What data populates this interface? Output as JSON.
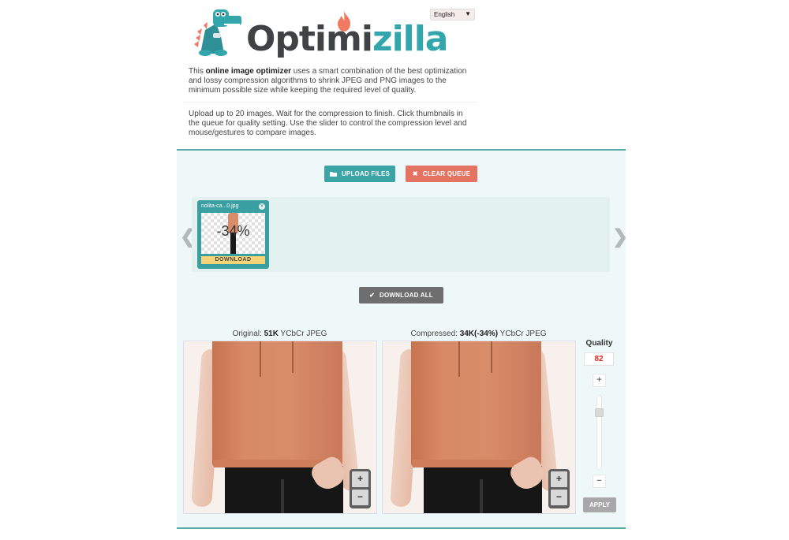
{
  "header": {
    "logo_text_dark": "Optimi",
    "logo_text_teal": "zilla",
    "language": "English"
  },
  "intro": {
    "prefix": "This ",
    "bold": "online image optimizer",
    "suffix": " uses a smart combination of the best optimization and lossy compression algorithms to shrink JPEG and PNG images to the minimum possible size while keeping the required level of quality."
  },
  "howto": "Upload up to 20 images. Wait for the compression to finish. Click thumbnails in the queue for quality setting. Use the slider to control the compression level and mouse/gestures to compare images.",
  "toolbar": {
    "upload_label": "UPLOAD FILES",
    "clear_label": "CLEAR QUEUE",
    "download_all_label": "DOWNLOAD ALL"
  },
  "queue": {
    "prev_arrow": "❮",
    "next_arrow": "❯",
    "items": [
      {
        "filename": "nolita-ca...0.jpg",
        "savings": "-34%",
        "download_label": "DOWNLOAD",
        "close_glyph": "×"
      }
    ]
  },
  "compare": {
    "original_prefix": "Original: ",
    "original_size": "51K",
    "original_suffix": " YCbCr JPEG",
    "compressed_prefix": "Compressed: ",
    "compressed_size": "34K(-34%)",
    "compressed_suffix": " YCbCr JPEG",
    "zoom_in": "+",
    "zoom_out": "−"
  },
  "quality": {
    "title": "Quality",
    "value": "82",
    "plus": "+",
    "minus": "−",
    "apply_label": "APPLY",
    "slider_fraction": 0.82
  },
  "colors": {
    "teal": "#3aa4a6",
    "coral": "#e47361",
    "gray_button": "#6e6e6e",
    "download_yellow": "#f7d478",
    "quality_red": "#e22222"
  }
}
